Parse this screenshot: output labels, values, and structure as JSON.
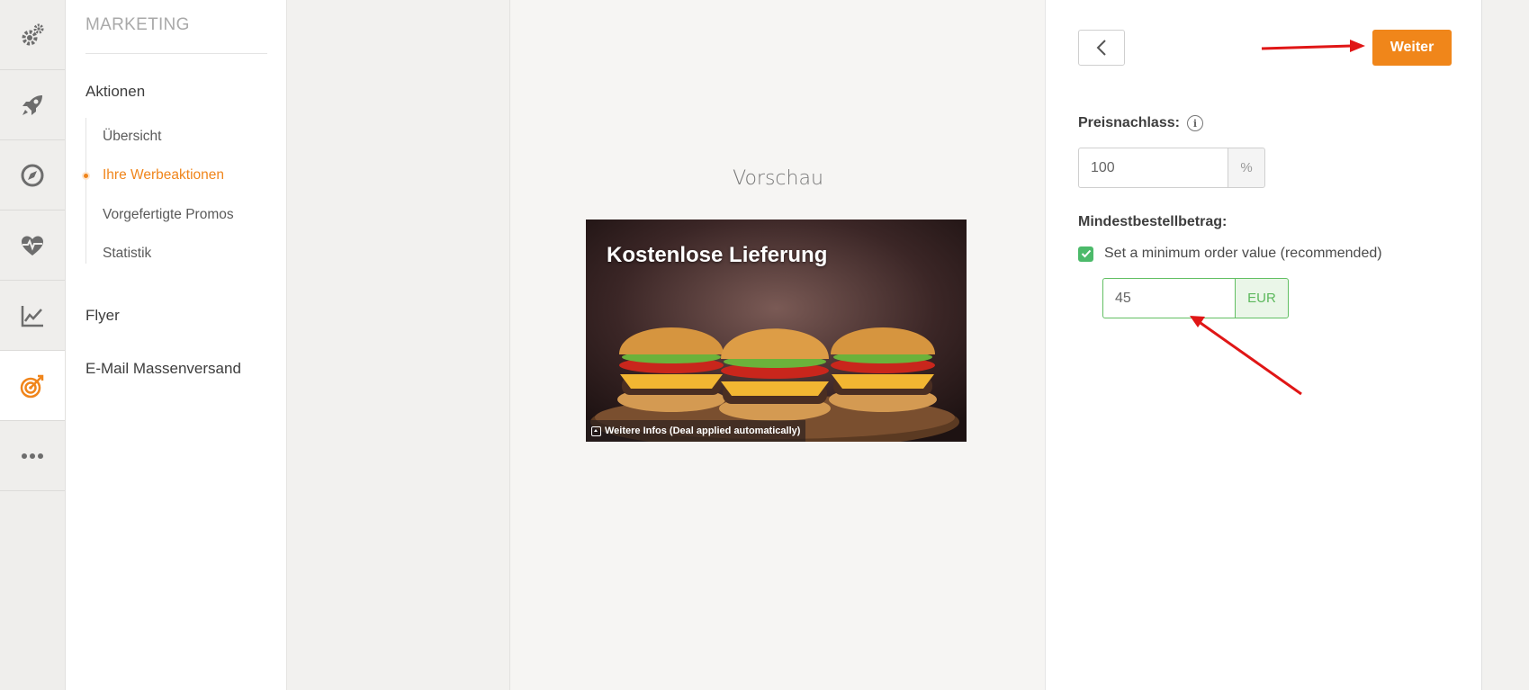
{
  "rail": {
    "items": [
      {
        "icon": "gears-icon",
        "active": false
      },
      {
        "icon": "rocket-icon",
        "active": false
      },
      {
        "icon": "compass-icon",
        "active": false
      },
      {
        "icon": "heart-pulse-icon",
        "active": false
      },
      {
        "icon": "line-chart-icon",
        "active": false
      },
      {
        "icon": "target-icon",
        "active": true
      },
      {
        "icon": "more-dots-icon",
        "active": false
      }
    ],
    "accent_color": "#f0851b"
  },
  "subnav": {
    "title": "MARKETING",
    "sections": {
      "aktionen": "Aktionen",
      "flyer": "Flyer",
      "email": "E-Mail Massenversand"
    },
    "items": {
      "uebersicht": "Übersicht",
      "werbeaktionen": "Ihre Werbeaktionen",
      "promos": "Vorgefertigte Promos",
      "statistik": "Statistik"
    },
    "active_item": "Ihre Werbeaktionen"
  },
  "preview": {
    "title": "Vorschau",
    "card": {
      "headline": "Kostenlose Lieferung",
      "info_text": "Weitere Infos (Deal applied automatically)"
    }
  },
  "form": {
    "next_label": "Weiter",
    "discount": {
      "label": "Preisnachlass:",
      "value": "100",
      "unit": "%"
    },
    "min_order": {
      "label": "Mindestbestellbetrag:",
      "checkbox_label": "Set a minimum order value (recommended)",
      "checked": true,
      "value": "45",
      "unit": "EUR"
    },
    "button_color": "#f0861a",
    "success_color": "#5cb85c"
  }
}
